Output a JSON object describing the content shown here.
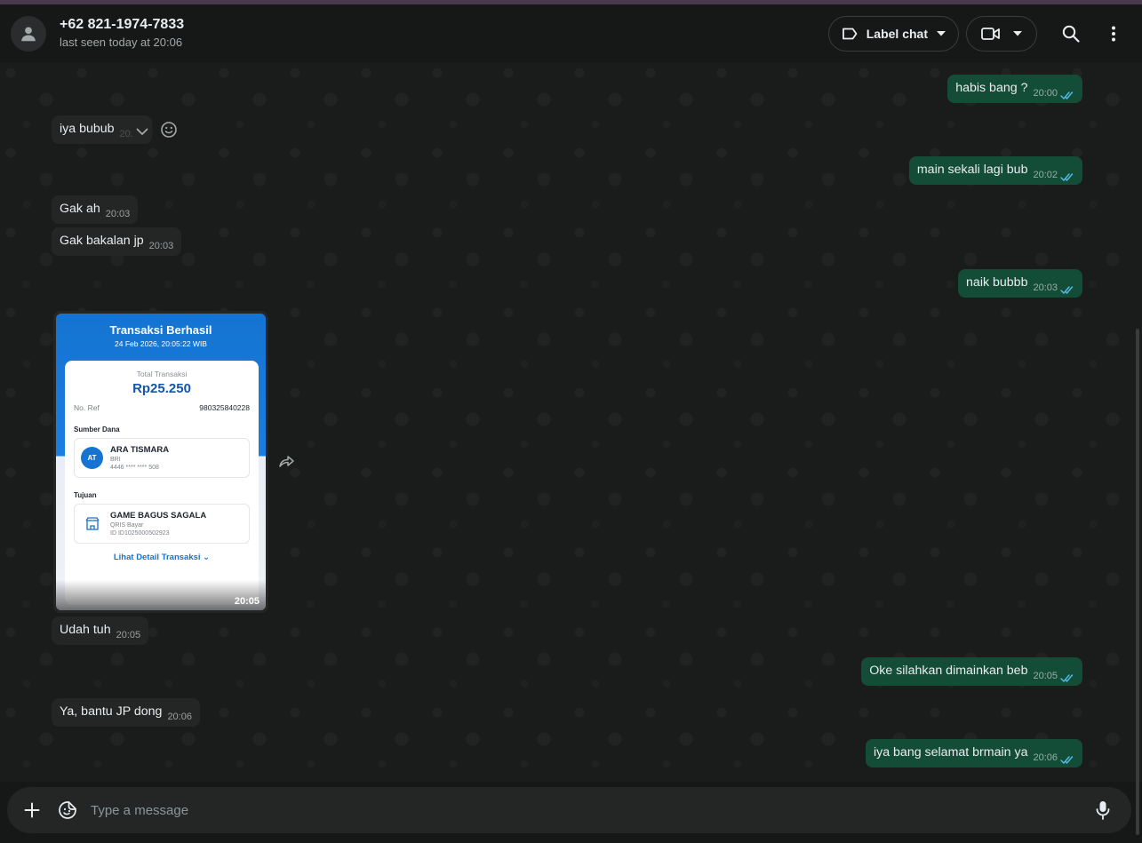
{
  "header": {
    "contact_name": "+62 821-1974-7833",
    "status": "last seen today at 20:06",
    "label_chat": "Label chat"
  },
  "messages": [
    {
      "dir": "out",
      "text": "habis bang ?",
      "time": "20:00"
    },
    {
      "dir": "in",
      "text": "iya bubub",
      "time": "20:00"
    },
    {
      "dir": "out",
      "text": "main sekali lagi bub",
      "time": "20:02"
    },
    {
      "dir": "in",
      "text": "Gak ah",
      "time": "20:03"
    },
    {
      "dir": "in",
      "text": "Gak bakalan jp",
      "time": "20:03"
    },
    {
      "dir": "out",
      "text": "naik bubbb",
      "time": "20:03"
    },
    {
      "dir": "in",
      "text": "Udah tuh",
      "time": "20:05"
    },
    {
      "dir": "out",
      "text": "Oke silahkan dimainkan beb",
      "time": "20:05"
    },
    {
      "dir": "in",
      "text": "Ya, bantu JP dong",
      "time": "20:06"
    },
    {
      "dir": "out",
      "text": "iya bang selamat brmain ya",
      "time": "20:06"
    }
  ],
  "image_message": {
    "time": "20:05",
    "receipt": {
      "title": "Transaksi Berhasil",
      "date": "24 Feb 2026, 20:05:22 WIB",
      "total_label": "Total Transaksi",
      "amount": "Rp25.250",
      "ref_label": "No. Ref",
      "ref_value": "980325840228",
      "source_label": "Sumber Dana",
      "source_initials": "AT",
      "source_name": "ARA TISMARA",
      "source_bank": "BRI",
      "source_account": "4446 **** **** 508",
      "dest_label": "Tujuan",
      "dest_name": "GAME BAGUS SAGALA",
      "dest_type": "QRIS Bayar",
      "dest_id": "ID ID1025000502923",
      "detail_link": "Lihat Detail Transaksi ⌄"
    }
  },
  "composer": {
    "placeholder": "Type a message"
  },
  "colors": {
    "outgoing_bubble": "#144d37",
    "incoming_bubble": "#242626",
    "read_ticks": "#53bdeb",
    "receipt_blue": "#1574d1"
  }
}
